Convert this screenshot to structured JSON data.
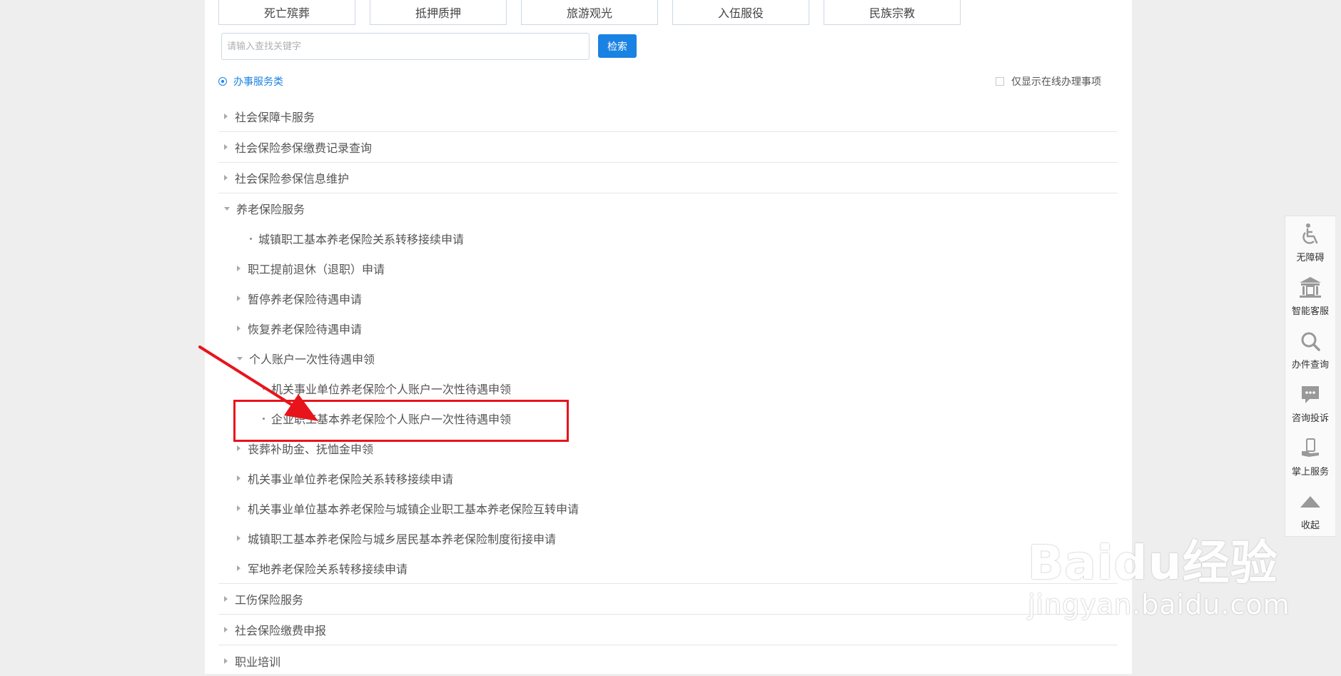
{
  "categories": [
    "死亡殡葬",
    "抵押质押",
    "旅游观光",
    "入伍服役",
    "民族宗教"
  ],
  "search": {
    "placeholder": "请输入查找关键字",
    "button_label": "检索"
  },
  "filter": {
    "radio_label": "办事服务类",
    "checkbox_label": "仅显示在线办理事项",
    "checkbox_checked": false
  },
  "tree": {
    "top1": "社会保障卡服务",
    "top2": "社会保险参保缴费记录查询",
    "top3": "社会保险参保信息维护",
    "top4": "养老保险服务",
    "pension": {
      "leaf1": "城镇职工基本养老保险关系转移接续申请",
      "item1": "职工提前退休（退职）申请",
      "item2": "暂停养老保险待遇申请",
      "item3": "恢复养老保险待遇申请",
      "item4": "个人账户一次性待遇申领",
      "item4_sub1": "机关事业单位养老保险个人账户一次性待遇申领",
      "item4_sub2": "企业职工基本养老保险个人账户一次性待遇申领",
      "item5": "丧葬补助金、抚恤金申领",
      "item6": "机关事业单位养老保险关系转移接续申请",
      "item7": "机关事业单位基本养老保险与城镇企业职工基本养老保险互转申请",
      "item8": "城镇职工基本养老保险与城乡居民基本养老保险制度衔接申请",
      "item9": "军地养老保险关系转移接续申请"
    },
    "top5": "工伤保险服务",
    "top6": "社会保险缴费申报",
    "top7": "职业培训"
  },
  "sidebar": {
    "accessibility": "无障碍",
    "smart_service": "智能客服",
    "query": "办件查询",
    "consult": "咨询投诉",
    "mobile": "掌上服务",
    "collapse": "收起"
  },
  "watermark": {
    "main": "Baidu经验",
    "sub": "jingyan.baidu.com"
  },
  "colors": {
    "accent": "#1a82e2",
    "highlight": "#e8141b"
  }
}
